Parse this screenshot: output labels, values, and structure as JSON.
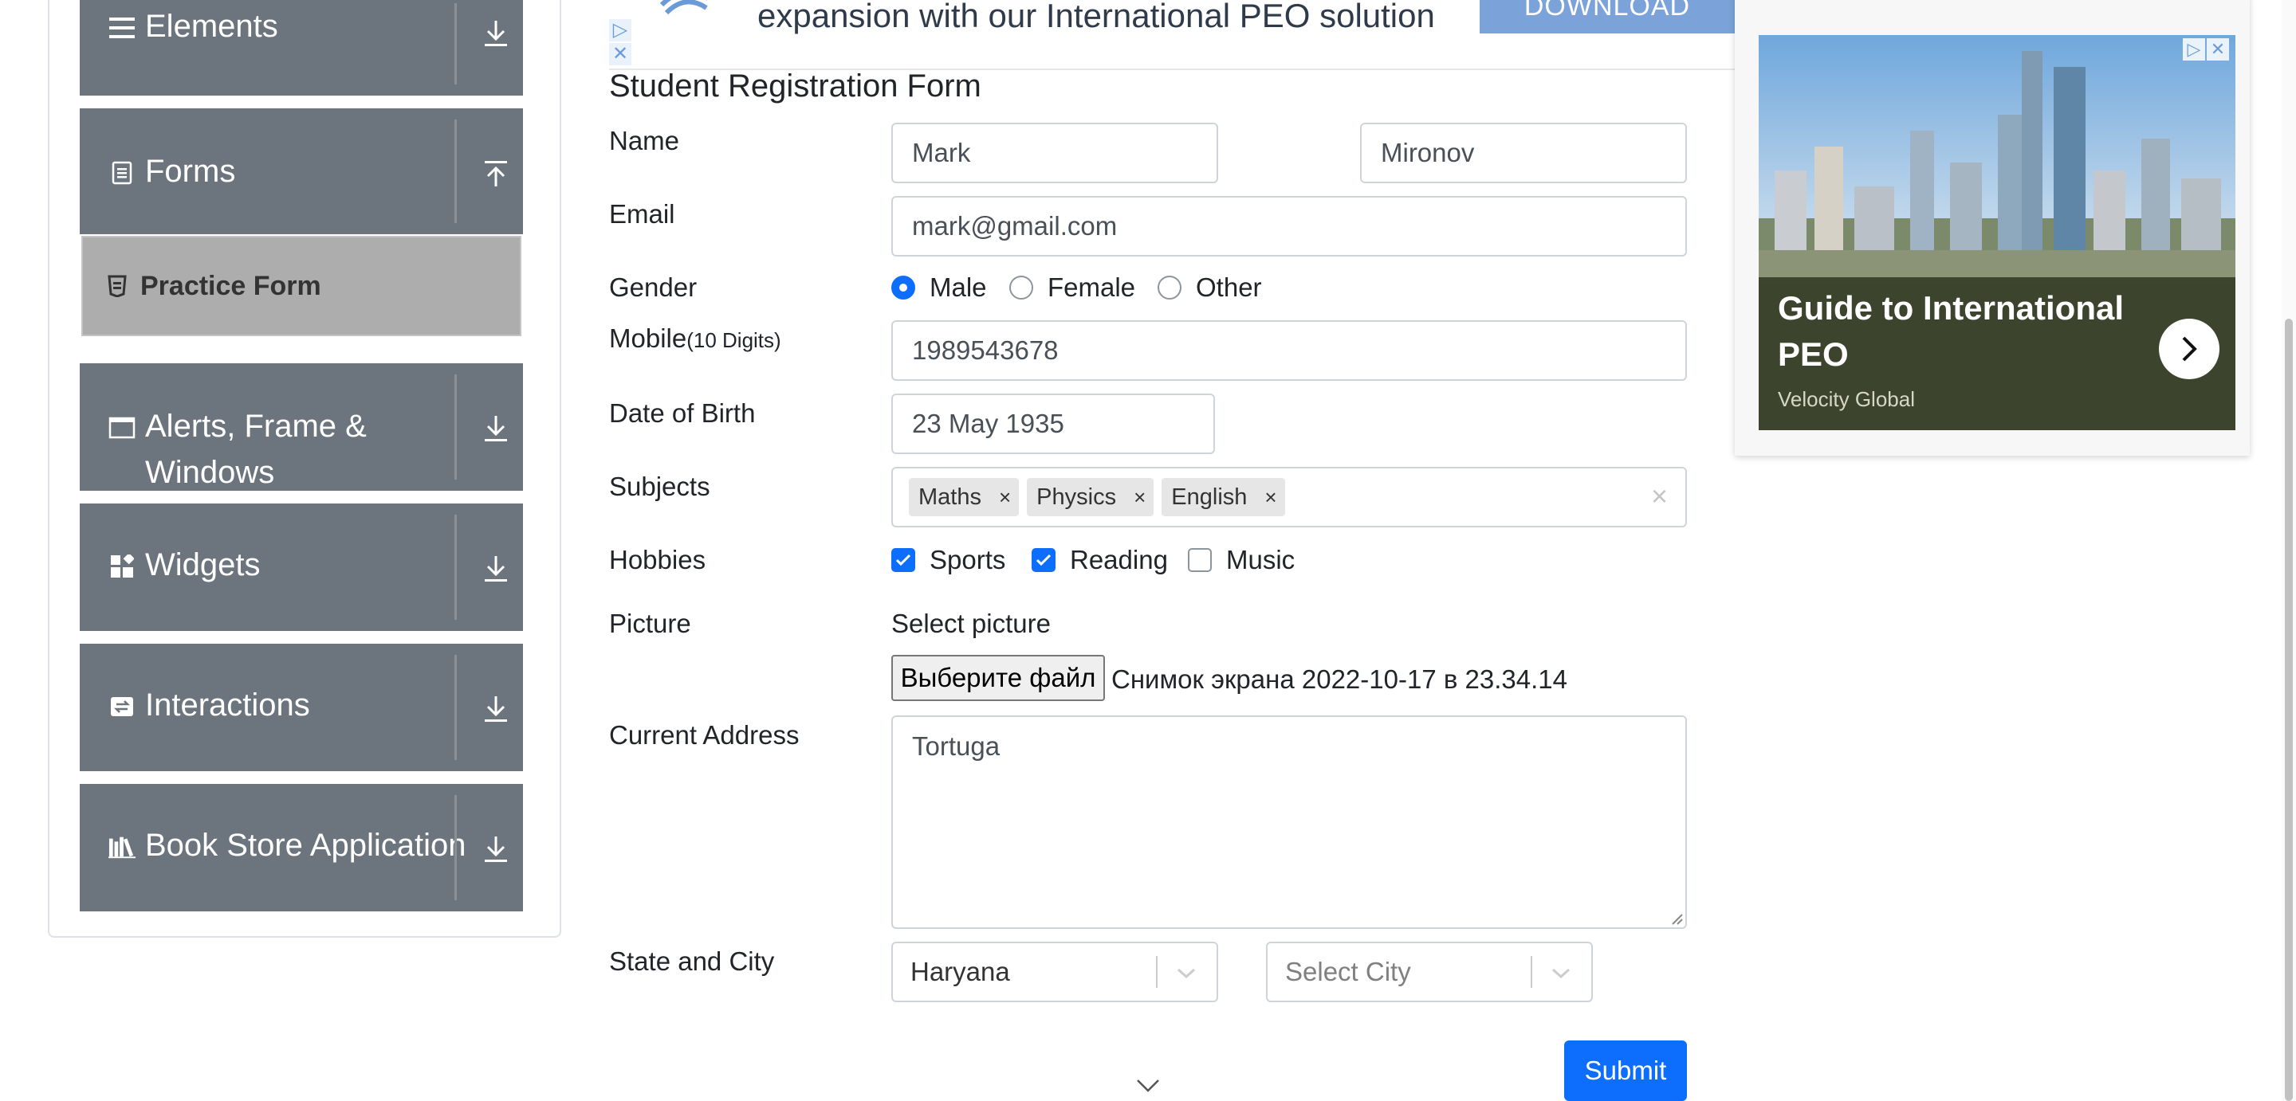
{
  "sidebar": {
    "groups": [
      {
        "label": "Elements",
        "icon": "list-icon",
        "arrow": "download-arrow-icon"
      },
      {
        "label": "Forms",
        "icon": "form-icon",
        "arrow": "upload-arrow-icon"
      },
      {
        "label": "Alerts, Frame &",
        "label2": "Windows",
        "icon": "window-icon",
        "arrow": "download-arrow-icon"
      },
      {
        "label": "Widgets",
        "icon": "widgets-icon",
        "arrow": "download-arrow-icon"
      },
      {
        "label": "Interactions",
        "icon": "interactions-icon",
        "arrow": "download-arrow-icon"
      },
      {
        "label": "Book Store Application",
        "icon": "books-icon",
        "arrow": "download-arrow-icon"
      }
    ],
    "active_item": {
      "label": "Practice Form",
      "icon": "practice-form-icon"
    }
  },
  "top_ad": {
    "text": "expansion with our International PEO solution",
    "button": "DOWNLOAD"
  },
  "form": {
    "title": "Student Registration Form",
    "name_label": "Name",
    "first_name": "Mark",
    "last_name": "Mironov",
    "email_label": "Email",
    "email": "mark@gmail.com",
    "gender_label": "Gender",
    "gender_options": [
      "Male",
      "Female",
      "Other"
    ],
    "gender_selected": "Male",
    "mobile_label": "Mobile",
    "mobile_hint": "(10 Digits)",
    "mobile": "1989543678",
    "dob_label": "Date of Birth",
    "dob": "23 May 1935",
    "subjects_label": "Subjects",
    "subjects": [
      "Maths",
      "Physics",
      "English"
    ],
    "chip_remove": "×",
    "clear_all": "×",
    "hobbies_label": "Hobbies",
    "hobbies": [
      {
        "label": "Sports",
        "checked": true
      },
      {
        "label": "Reading",
        "checked": true
      },
      {
        "label": "Music",
        "checked": false
      }
    ],
    "picture_label": "Picture",
    "select_picture": "Select picture",
    "file_button": "Выберите файл",
    "file_name": "Снимок экрана 2022-10-17 в 23.34.14",
    "address_label": "Current Address",
    "address": "Tortuga",
    "state_city_label": "State and City",
    "state": "Haryana",
    "city_placeholder": "Select City",
    "submit": "Submit"
  },
  "right_ad": {
    "headline": "Guide to International PEO",
    "brand": "Velocity Global"
  },
  "colors": {
    "sidebar_group": "#6c757d",
    "active_item": "#adadad",
    "primary": "#0d6efd",
    "ad_button": "#7ba3d9"
  }
}
